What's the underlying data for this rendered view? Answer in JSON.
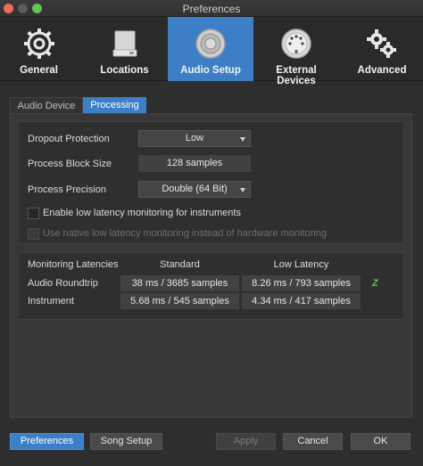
{
  "window": {
    "title": "Preferences"
  },
  "toolbar": {
    "tabs": [
      {
        "label": "General",
        "icon": "sync-gear-icon"
      },
      {
        "label": "Locations",
        "icon": "drive-icon"
      },
      {
        "label": "Audio Setup",
        "icon": "speaker-icon",
        "active": true
      },
      {
        "label": "External Devices",
        "icon": "din-connector-icon"
      },
      {
        "label": "Advanced",
        "icon": "gears-icon"
      }
    ]
  },
  "subtabs": {
    "audio_device": "Audio Device",
    "processing": "Processing"
  },
  "processing": {
    "dropout_label": "Dropout Protection",
    "dropout_value": "Low",
    "block_size_label": "Process Block Size",
    "block_size_value": "128 samples",
    "precision_label": "Process Precision",
    "precision_value": "Double (64 Bit)",
    "low_latency_label": "Enable low latency monitoring for instruments",
    "native_label": "Use native low latency monitoring instead of hardware monitoring"
  },
  "latencies": {
    "title": "Monitoring Latencies",
    "col_standard": "Standard",
    "col_low": "Low Latency",
    "rows": [
      {
        "label": "Audio Roundtrip",
        "standard": "38 ms / 3685 samples",
        "low": "8.26 ms / 793 samples",
        "indicator": "Z"
      },
      {
        "label": "Instrument",
        "standard": "5.68 ms / 545 samples",
        "low": "4.34 ms / 417 samples"
      }
    ]
  },
  "buttons": {
    "preferences": "Preferences",
    "song_setup": "Song Setup",
    "apply": "Apply",
    "cancel": "Cancel",
    "ok": "OK"
  },
  "colors": {
    "accent": "#3d7fc6",
    "indicator": "#4cc752"
  }
}
